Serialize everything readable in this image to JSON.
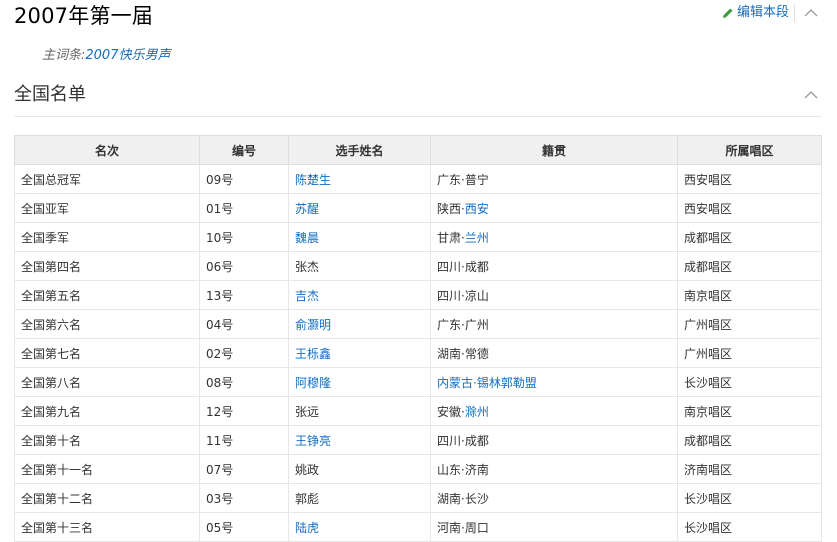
{
  "header": {
    "title": "2007年第一届",
    "edit_label": "编辑本段",
    "main_entry_prefix": "主词条:",
    "main_entry_link": "2007快乐男声"
  },
  "section": {
    "title": "全国名单"
  },
  "table": {
    "headers": [
      "名次",
      "编号",
      "选手姓名",
      "籍贯",
      "所属唱区"
    ],
    "rows": [
      {
        "rank": "全国总冠军",
        "num": "09号",
        "name": "陈楚生",
        "name_link": true,
        "origin_a": "广东·普宁",
        "origin_b": "",
        "origin_link": false,
        "region": "西安唱区"
      },
      {
        "rank": "全国亚军",
        "num": "01号",
        "name": "苏醒",
        "name_link": true,
        "origin_a": "陕西·",
        "origin_b": "西安",
        "origin_link": true,
        "region": "西安唱区"
      },
      {
        "rank": "全国季军",
        "num": "10号",
        "name": "魏晨",
        "name_link": true,
        "origin_a": "甘肃·",
        "origin_b": "兰州",
        "origin_link": true,
        "region": "成都唱区"
      },
      {
        "rank": "全国第四名",
        "num": "06号",
        "name": "张杰",
        "name_link": false,
        "origin_a": "四川·成都",
        "origin_b": "",
        "origin_link": false,
        "region": "成都唱区"
      },
      {
        "rank": "全国第五名",
        "num": "13号",
        "name": "吉杰",
        "name_link": true,
        "origin_a": "四川·凉山",
        "origin_b": "",
        "origin_link": false,
        "region": "南京唱区"
      },
      {
        "rank": "全国第六名",
        "num": "04号",
        "name": "俞灏明",
        "name_link": true,
        "origin_a": "广东·广州",
        "origin_b": "",
        "origin_link": false,
        "region": "广州唱区"
      },
      {
        "rank": "全国第七名",
        "num": "02号",
        "name": "王栎鑫",
        "name_link": true,
        "origin_a": "湖南·常德",
        "origin_b": "",
        "origin_link": false,
        "region": "广州唱区"
      },
      {
        "rank": "全国第八名",
        "num": "08号",
        "name": "阿穆隆",
        "name_link": true,
        "origin_a": "",
        "origin_b": "内蒙古·锡林郭勒盟",
        "origin_link": true,
        "region": "长沙唱区"
      },
      {
        "rank": "全国第九名",
        "num": "12号",
        "name": "张远",
        "name_link": false,
        "origin_a": "安徽·",
        "origin_b": "滁州",
        "origin_link": true,
        "region": "南京唱区"
      },
      {
        "rank": "全国第十名",
        "num": "11号",
        "name": "王铮亮",
        "name_link": true,
        "origin_a": "四川·成都",
        "origin_b": "",
        "origin_link": false,
        "region": "成都唱区"
      },
      {
        "rank": "全国第十一名",
        "num": "07号",
        "name": "姚政",
        "name_link": false,
        "origin_a": "山东·济南",
        "origin_b": "",
        "origin_link": false,
        "region": "济南唱区"
      },
      {
        "rank": "全国第十二名",
        "num": "03号",
        "name": "郭彪",
        "name_link": false,
        "origin_a": "湖南·长沙",
        "origin_b": "",
        "origin_link": false,
        "region": "长沙唱区"
      },
      {
        "rank": "全国第十三名",
        "num": "05号",
        "name": "陆虎",
        "name_link": true,
        "origin_a": "河南·周口",
        "origin_b": "",
        "origin_link": false,
        "region": "长沙唱区"
      }
    ]
  }
}
